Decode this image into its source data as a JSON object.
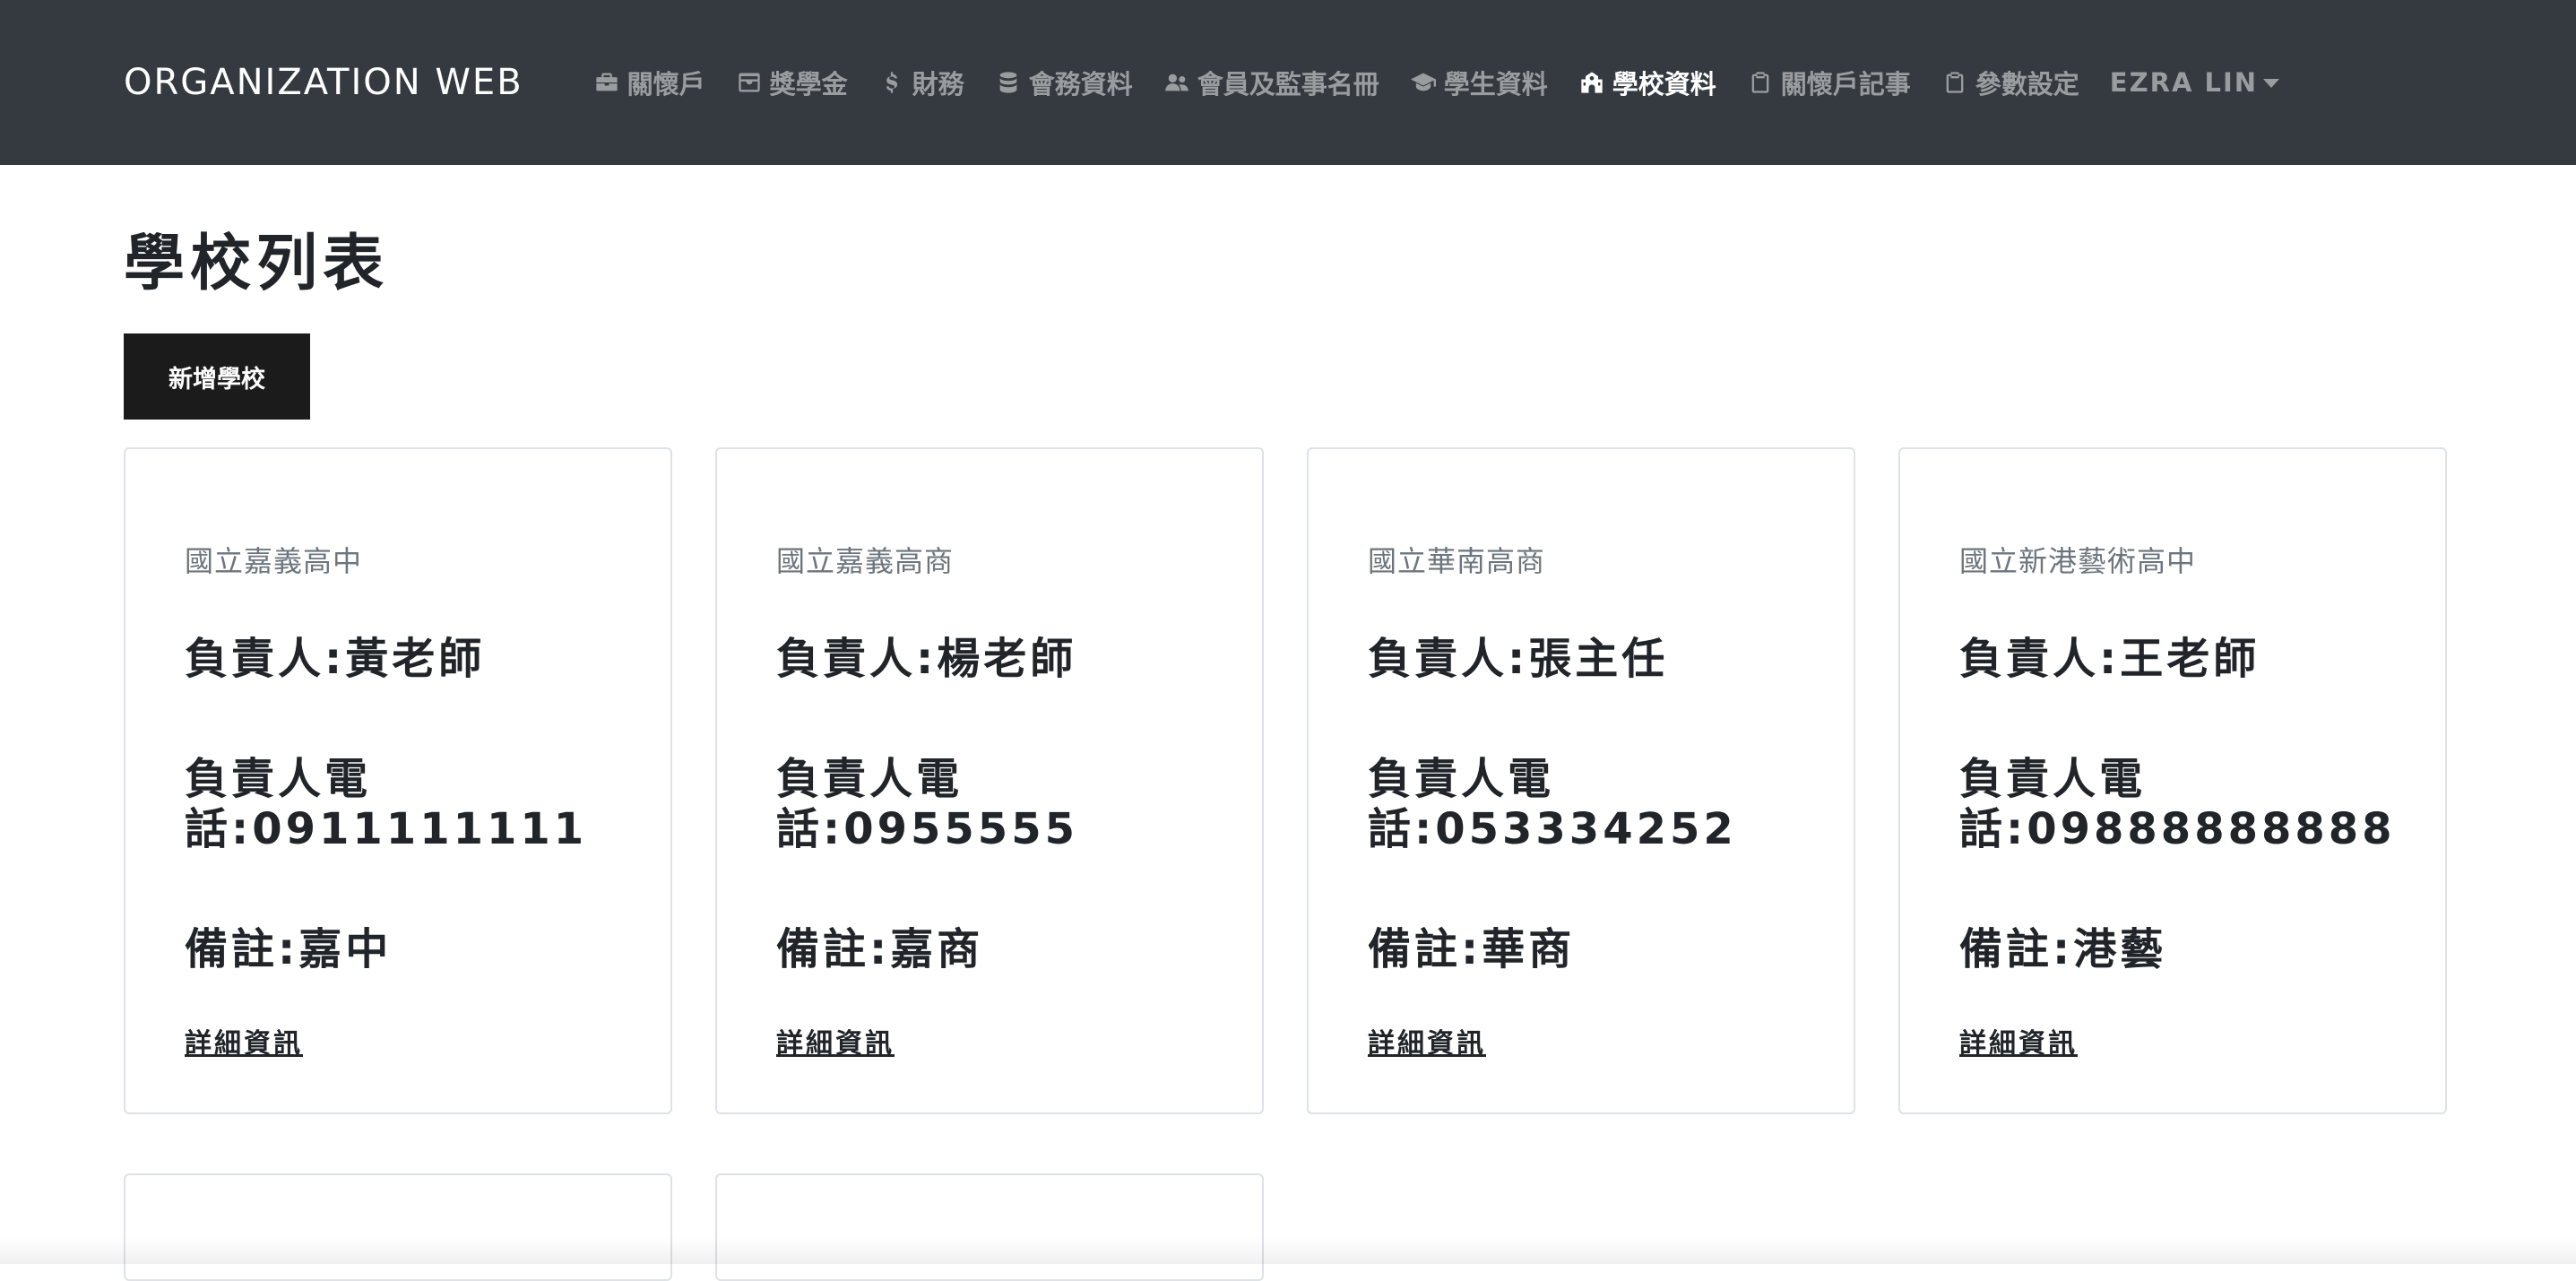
{
  "navbar": {
    "brand": "ORGANIZATION WEB",
    "items": [
      {
        "label": "關懷戶",
        "icon": "briefcase-icon"
      },
      {
        "label": "獎學金",
        "icon": "archive-box-icon"
      },
      {
        "label": "財務",
        "icon": "dollar-icon"
      },
      {
        "label": "會務資料",
        "icon": "database-icon"
      },
      {
        "label": "會員及監事名冊",
        "icon": "users-icon"
      },
      {
        "label": "學生資料",
        "icon": "graduation-cap-icon"
      },
      {
        "label": "學校資料",
        "icon": "school-icon",
        "active": true
      },
      {
        "label": "關懷戶記事",
        "icon": "clipboard-icon"
      },
      {
        "label": "參數設定",
        "icon": "clipboard-icon"
      }
    ],
    "user": "EZRA LIN"
  },
  "page": {
    "title": "學校列表",
    "add_button": "新增學校"
  },
  "schools": [
    {
      "name": "國立嘉義高中",
      "contact": "負責人:黃老師",
      "phone_1": "負責人電",
      "phone_2": "話:0911111111",
      "note": "備註:嘉中",
      "detail": "詳細資訊"
    },
    {
      "name": "國立嘉義高商",
      "contact": "負責人:楊老師",
      "phone_1": "負責人電",
      "phone_2": "話:0955555",
      "note": "備註:嘉商",
      "detail": "詳細資訊"
    },
    {
      "name": "國立華南高商",
      "contact": "負責人:張主任",
      "phone_1": "負責人電",
      "phone_2": "話:053334252",
      "note": "備註:華商",
      "detail": "詳細資訊"
    },
    {
      "name": "國立新港藝術高中",
      "contact": "負責人:王老師",
      "phone_1": "負責人電",
      "phone_2": "話:09888888888",
      "note": "備註:港藝",
      "detail": "詳細資訊"
    }
  ],
  "colors": {
    "navbar_bg": "#343a40",
    "nav_text": "#9a9da0",
    "nav_active": "#ffffff",
    "button_bg": "#1b1b1b",
    "card_border": "#dee2e6"
  }
}
